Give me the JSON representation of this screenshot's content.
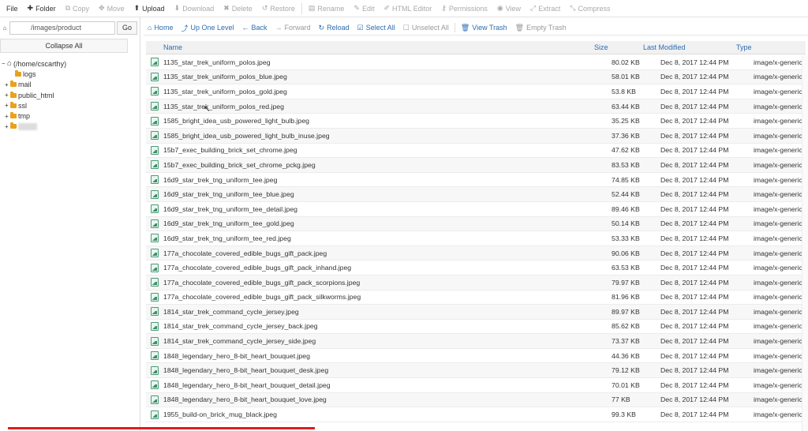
{
  "toolbar": {
    "items": [
      {
        "label": "File",
        "icon": "",
        "enabled": true
      },
      {
        "label": "Folder",
        "icon": "plus-icon",
        "enabled": true
      },
      {
        "label": "Copy",
        "icon": "copy-icon",
        "enabled": false
      },
      {
        "label": "Move",
        "icon": "move-icon",
        "enabled": false
      },
      {
        "label": "Upload",
        "icon": "upload-icon",
        "enabled": true
      },
      {
        "label": "Download",
        "icon": "download-icon",
        "enabled": false
      },
      {
        "label": "Delete",
        "icon": "delete-icon",
        "enabled": false
      },
      {
        "label": "Restore",
        "icon": "restore-icon",
        "enabled": false
      },
      {
        "label": "Rename",
        "icon": "rename-icon",
        "enabled": false
      },
      {
        "label": "Edit",
        "icon": "edit-icon",
        "enabled": false
      },
      {
        "label": "HTML Editor",
        "icon": "html-editor-icon",
        "enabled": false
      },
      {
        "label": "Permissions",
        "icon": "key-icon",
        "enabled": false
      },
      {
        "label": "View",
        "icon": "eye-icon",
        "enabled": false
      },
      {
        "label": "Extract",
        "icon": "extract-icon",
        "enabled": false
      },
      {
        "label": "Compress",
        "icon": "compress-icon",
        "enabled": false
      }
    ]
  },
  "left": {
    "path_value": "/images/product",
    "go_label": "Go",
    "collapse_label": "Collapse All",
    "tree": [
      {
        "label": "(/home/cscarthy)",
        "kind": "home"
      },
      {
        "label": "logs",
        "kind": "folder"
      },
      {
        "label": "mail",
        "kind": "folder-expandable"
      },
      {
        "label": "public_html",
        "kind": "folder-expandable"
      },
      {
        "label": "ssl",
        "kind": "folder-expandable"
      },
      {
        "label": "tmp",
        "kind": "folder-expandable"
      },
      {
        "label": "",
        "kind": "folder-blurred"
      }
    ]
  },
  "subbar": {
    "items": [
      {
        "label": "Home",
        "icon": "home-icon",
        "enabled": true
      },
      {
        "label": "Up One Level",
        "icon": "up-arrow-icon",
        "enabled": true
      },
      {
        "label": "Back",
        "icon": "left-arrow-icon",
        "enabled": true
      },
      {
        "label": "Forward",
        "icon": "right-arrow-icon",
        "enabled": false
      },
      {
        "label": "Reload",
        "icon": "reload-icon",
        "enabled": true
      },
      {
        "label": "Select All",
        "icon": "checkbox-checked-icon",
        "enabled": true
      },
      {
        "label": "Unselect All",
        "icon": "checkbox-empty-icon",
        "enabled": false
      },
      {
        "label": "View Trash",
        "icon": "trash-icon",
        "enabled": true
      },
      {
        "label": "Empty Trash",
        "icon": "trash-icon",
        "enabled": false
      }
    ]
  },
  "table": {
    "headers": {
      "name": "Name",
      "size": "Size",
      "modified": "Last Modified",
      "type": "Type"
    },
    "rows": [
      {
        "name": "1135_star_trek_uniform_polos.jpeg",
        "size": "80.02 KB",
        "modified": "Dec 8, 2017 12:44 PM",
        "type": "image/x-generic"
      },
      {
        "name": "1135_star_trek_uniform_polos_blue.jpeg",
        "size": "58.01 KB",
        "modified": "Dec 8, 2017 12:44 PM",
        "type": "image/x-generic"
      },
      {
        "name": "1135_star_trek_uniform_polos_gold.jpeg",
        "size": "53.8 KB",
        "modified": "Dec 8, 2017 12:44 PM",
        "type": "image/x-generic"
      },
      {
        "name": "1135_star_trek_uniform_polos_red.jpeg",
        "size": "63.44 KB",
        "modified": "Dec 8, 2017 12:44 PM",
        "type": "image/x-generic"
      },
      {
        "name": "1585_bright_idea_usb_powered_light_bulb.jpeg",
        "size": "35.25 KB",
        "modified": "Dec 8, 2017 12:44 PM",
        "type": "image/x-generic"
      },
      {
        "name": "1585_bright_idea_usb_powered_light_bulb_inuse.jpeg",
        "size": "37.36 KB",
        "modified": "Dec 8, 2017 12:44 PM",
        "type": "image/x-generic"
      },
      {
        "name": "15b7_exec_building_brick_set_chrome.jpeg",
        "size": "47.62 KB",
        "modified": "Dec 8, 2017 12:44 PM",
        "type": "image/x-generic"
      },
      {
        "name": "15b7_exec_building_brick_set_chrome_pckg.jpeg",
        "size": "83.53 KB",
        "modified": "Dec 8, 2017 12:44 PM",
        "type": "image/x-generic"
      },
      {
        "name": "16d9_star_trek_tng_uniform_tee.jpeg",
        "size": "74.85 KB",
        "modified": "Dec 8, 2017 12:44 PM",
        "type": "image/x-generic"
      },
      {
        "name": "16d9_star_trek_tng_uniform_tee_blue.jpeg",
        "size": "52.44 KB",
        "modified": "Dec 8, 2017 12:44 PM",
        "type": "image/x-generic"
      },
      {
        "name": "16d9_star_trek_tng_uniform_tee_detail.jpeg",
        "size": "89.46 KB",
        "modified": "Dec 8, 2017 12:44 PM",
        "type": "image/x-generic"
      },
      {
        "name": "16d9_star_trek_tng_uniform_tee_gold.jpeg",
        "size": "50.14 KB",
        "modified": "Dec 8, 2017 12:44 PM",
        "type": "image/x-generic"
      },
      {
        "name": "16d9_star_trek_tng_uniform_tee_red.jpeg",
        "size": "53.33 KB",
        "modified": "Dec 8, 2017 12:44 PM",
        "type": "image/x-generic"
      },
      {
        "name": "177a_chocolate_covered_edible_bugs_gift_pack.jpeg",
        "size": "90.06 KB",
        "modified": "Dec 8, 2017 12:44 PM",
        "type": "image/x-generic"
      },
      {
        "name": "177a_chocolate_covered_edible_bugs_gift_pack_inhand.jpeg",
        "size": "63.53 KB",
        "modified": "Dec 8, 2017 12:44 PM",
        "type": "image/x-generic"
      },
      {
        "name": "177a_chocolate_covered_edible_bugs_gift_pack_scorpions.jpeg",
        "size": "79.97 KB",
        "modified": "Dec 8, 2017 12:44 PM",
        "type": "image/x-generic"
      },
      {
        "name": "177a_chocolate_covered_edible_bugs_gift_pack_silkworms.jpeg",
        "size": "81.96 KB",
        "modified": "Dec 8, 2017 12:44 PM",
        "type": "image/x-generic"
      },
      {
        "name": "1814_star_trek_command_cycle_jersey.jpeg",
        "size": "89.97 KB",
        "modified": "Dec 8, 2017 12:44 PM",
        "type": "image/x-generic"
      },
      {
        "name": "1814_star_trek_command_cycle_jersey_back.jpeg",
        "size": "85.62 KB",
        "modified": "Dec 8, 2017 12:44 PM",
        "type": "image/x-generic"
      },
      {
        "name": "1814_star_trek_command_cycle_jersey_side.jpeg",
        "size": "73.37 KB",
        "modified": "Dec 8, 2017 12:44 PM",
        "type": "image/x-generic"
      },
      {
        "name": "1848_legendary_hero_8-bit_heart_bouquet.jpeg",
        "size": "44.36 KB",
        "modified": "Dec 8, 2017 12:44 PM",
        "type": "image/x-generic"
      },
      {
        "name": "1848_legendary_hero_8-bit_heart_bouquet_desk.jpeg",
        "size": "79.12 KB",
        "modified": "Dec 8, 2017 12:44 PM",
        "type": "image/x-generic"
      },
      {
        "name": "1848_legendary_hero_8-bit_heart_bouquet_detail.jpeg",
        "size": "70.01 KB",
        "modified": "Dec 8, 2017 12:44 PM",
        "type": "image/x-generic"
      },
      {
        "name": "1848_legendary_hero_8-bit_heart_bouquet_love.jpeg",
        "size": "77 KB",
        "modified": "Dec 8, 2017 12:44 PM",
        "type": "image/x-generic"
      },
      {
        "name": "1955_build-on_brick_mug_black.jpeg",
        "size": "99.3 KB",
        "modified": "Dec 8, 2017 12:44 PM",
        "type": "image/x-generic"
      }
    ]
  },
  "video_progress": 0.38,
  "colors": {
    "link": "#2b6cb0",
    "folder": "#e8a21b",
    "progress": "#e31b1b"
  }
}
